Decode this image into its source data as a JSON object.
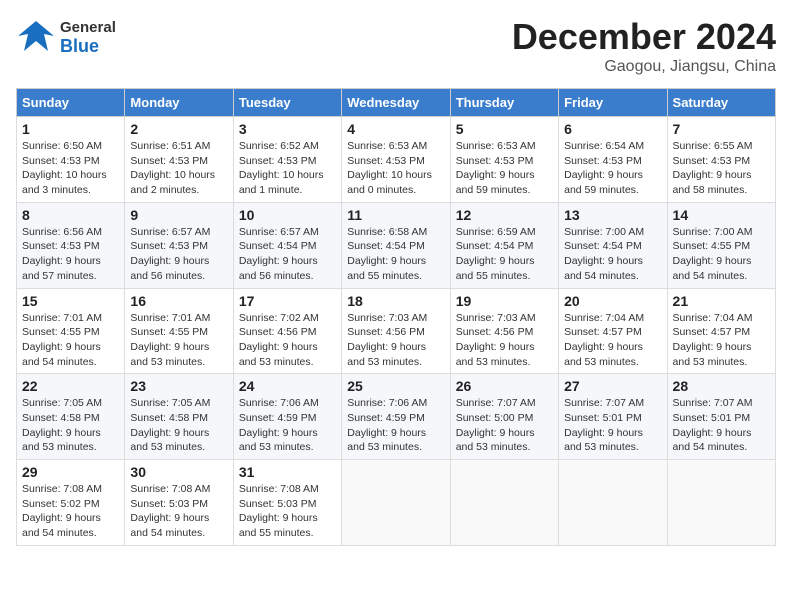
{
  "header": {
    "logo_general": "General",
    "logo_blue": "Blue",
    "month_title": "December 2024",
    "location": "Gaogou, Jiangsu, China"
  },
  "days_of_week": [
    "Sunday",
    "Monday",
    "Tuesday",
    "Wednesday",
    "Thursday",
    "Friday",
    "Saturday"
  ],
  "weeks": [
    [
      {
        "day": "1",
        "sunrise": "Sunrise: 6:50 AM",
        "sunset": "Sunset: 4:53 PM",
        "daylight": "Daylight: 10 hours and 3 minutes."
      },
      {
        "day": "2",
        "sunrise": "Sunrise: 6:51 AM",
        "sunset": "Sunset: 4:53 PM",
        "daylight": "Daylight: 10 hours and 2 minutes."
      },
      {
        "day": "3",
        "sunrise": "Sunrise: 6:52 AM",
        "sunset": "Sunset: 4:53 PM",
        "daylight": "Daylight: 10 hours and 1 minute."
      },
      {
        "day": "4",
        "sunrise": "Sunrise: 6:53 AM",
        "sunset": "Sunset: 4:53 PM",
        "daylight": "Daylight: 10 hours and 0 minutes."
      },
      {
        "day": "5",
        "sunrise": "Sunrise: 6:53 AM",
        "sunset": "Sunset: 4:53 PM",
        "daylight": "Daylight: 9 hours and 59 minutes."
      },
      {
        "day": "6",
        "sunrise": "Sunrise: 6:54 AM",
        "sunset": "Sunset: 4:53 PM",
        "daylight": "Daylight: 9 hours and 59 minutes."
      },
      {
        "day": "7",
        "sunrise": "Sunrise: 6:55 AM",
        "sunset": "Sunset: 4:53 PM",
        "daylight": "Daylight: 9 hours and 58 minutes."
      }
    ],
    [
      {
        "day": "8",
        "sunrise": "Sunrise: 6:56 AM",
        "sunset": "Sunset: 4:53 PM",
        "daylight": "Daylight: 9 hours and 57 minutes."
      },
      {
        "day": "9",
        "sunrise": "Sunrise: 6:57 AM",
        "sunset": "Sunset: 4:53 PM",
        "daylight": "Daylight: 9 hours and 56 minutes."
      },
      {
        "day": "10",
        "sunrise": "Sunrise: 6:57 AM",
        "sunset": "Sunset: 4:54 PM",
        "daylight": "Daylight: 9 hours and 56 minutes."
      },
      {
        "day": "11",
        "sunrise": "Sunrise: 6:58 AM",
        "sunset": "Sunset: 4:54 PM",
        "daylight": "Daylight: 9 hours and 55 minutes."
      },
      {
        "day": "12",
        "sunrise": "Sunrise: 6:59 AM",
        "sunset": "Sunset: 4:54 PM",
        "daylight": "Daylight: 9 hours and 55 minutes."
      },
      {
        "day": "13",
        "sunrise": "Sunrise: 7:00 AM",
        "sunset": "Sunset: 4:54 PM",
        "daylight": "Daylight: 9 hours and 54 minutes."
      },
      {
        "day": "14",
        "sunrise": "Sunrise: 7:00 AM",
        "sunset": "Sunset: 4:55 PM",
        "daylight": "Daylight: 9 hours and 54 minutes."
      }
    ],
    [
      {
        "day": "15",
        "sunrise": "Sunrise: 7:01 AM",
        "sunset": "Sunset: 4:55 PM",
        "daylight": "Daylight: 9 hours and 54 minutes."
      },
      {
        "day": "16",
        "sunrise": "Sunrise: 7:01 AM",
        "sunset": "Sunset: 4:55 PM",
        "daylight": "Daylight: 9 hours and 53 minutes."
      },
      {
        "day": "17",
        "sunrise": "Sunrise: 7:02 AM",
        "sunset": "Sunset: 4:56 PM",
        "daylight": "Daylight: 9 hours and 53 minutes."
      },
      {
        "day": "18",
        "sunrise": "Sunrise: 7:03 AM",
        "sunset": "Sunset: 4:56 PM",
        "daylight": "Daylight: 9 hours and 53 minutes."
      },
      {
        "day": "19",
        "sunrise": "Sunrise: 7:03 AM",
        "sunset": "Sunset: 4:56 PM",
        "daylight": "Daylight: 9 hours and 53 minutes."
      },
      {
        "day": "20",
        "sunrise": "Sunrise: 7:04 AM",
        "sunset": "Sunset: 4:57 PM",
        "daylight": "Daylight: 9 hours and 53 minutes."
      },
      {
        "day": "21",
        "sunrise": "Sunrise: 7:04 AM",
        "sunset": "Sunset: 4:57 PM",
        "daylight": "Daylight: 9 hours and 53 minutes."
      }
    ],
    [
      {
        "day": "22",
        "sunrise": "Sunrise: 7:05 AM",
        "sunset": "Sunset: 4:58 PM",
        "daylight": "Daylight: 9 hours and 53 minutes."
      },
      {
        "day": "23",
        "sunrise": "Sunrise: 7:05 AM",
        "sunset": "Sunset: 4:58 PM",
        "daylight": "Daylight: 9 hours and 53 minutes."
      },
      {
        "day": "24",
        "sunrise": "Sunrise: 7:06 AM",
        "sunset": "Sunset: 4:59 PM",
        "daylight": "Daylight: 9 hours and 53 minutes."
      },
      {
        "day": "25",
        "sunrise": "Sunrise: 7:06 AM",
        "sunset": "Sunset: 4:59 PM",
        "daylight": "Daylight: 9 hours and 53 minutes."
      },
      {
        "day": "26",
        "sunrise": "Sunrise: 7:07 AM",
        "sunset": "Sunset: 5:00 PM",
        "daylight": "Daylight: 9 hours and 53 minutes."
      },
      {
        "day": "27",
        "sunrise": "Sunrise: 7:07 AM",
        "sunset": "Sunset: 5:01 PM",
        "daylight": "Daylight: 9 hours and 53 minutes."
      },
      {
        "day": "28",
        "sunrise": "Sunrise: 7:07 AM",
        "sunset": "Sunset: 5:01 PM",
        "daylight": "Daylight: 9 hours and 54 minutes."
      }
    ],
    [
      {
        "day": "29",
        "sunrise": "Sunrise: 7:08 AM",
        "sunset": "Sunset: 5:02 PM",
        "daylight": "Daylight: 9 hours and 54 minutes."
      },
      {
        "day": "30",
        "sunrise": "Sunrise: 7:08 AM",
        "sunset": "Sunset: 5:03 PM",
        "daylight": "Daylight: 9 hours and 54 minutes."
      },
      {
        "day": "31",
        "sunrise": "Sunrise: 7:08 AM",
        "sunset": "Sunset: 5:03 PM",
        "daylight": "Daylight: 9 hours and 55 minutes."
      },
      null,
      null,
      null,
      null
    ]
  ]
}
